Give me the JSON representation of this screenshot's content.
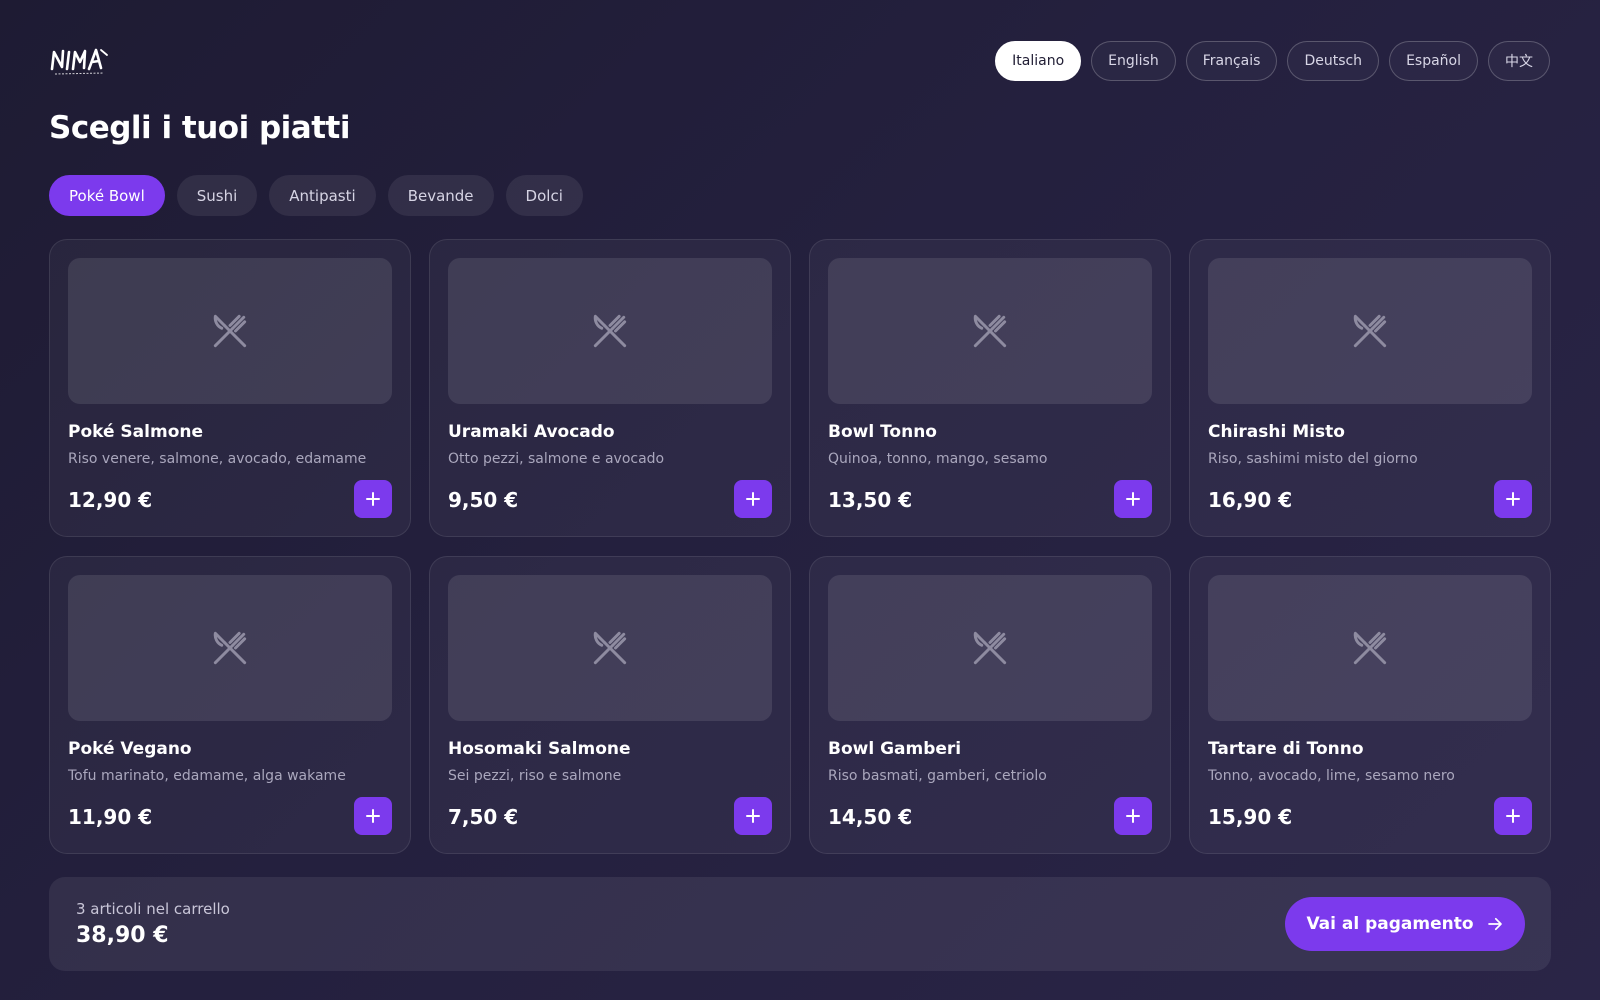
{
  "brand": {
    "logo_icon": "nima-logo"
  },
  "languages": [
    {
      "label": "Italiano",
      "active": true
    },
    {
      "label": "English",
      "active": false
    },
    {
      "label": "Français",
      "active": false
    },
    {
      "label": "Deutsch",
      "active": false
    },
    {
      "label": "Español",
      "active": false
    },
    {
      "label": "中文",
      "active": false
    }
  ],
  "page": {
    "title": "Scegli i tuoi piatti"
  },
  "categories": [
    {
      "label": "Poké Bowl",
      "active": true
    },
    {
      "label": "Sushi",
      "active": false
    },
    {
      "label": "Antipasti",
      "active": false
    },
    {
      "label": "Bevande",
      "active": false
    },
    {
      "label": "Dolci",
      "active": false
    }
  ],
  "dishes": [
    {
      "name": "Poké Salmone",
      "description": "Riso venere, salmone, avocado, edamame",
      "price": "12,90 €"
    },
    {
      "name": "Uramaki Avocado",
      "description": "Otto pezzi, salmone e avocado",
      "price": "9,50 €"
    },
    {
      "name": "Bowl Tonno",
      "description": "Quinoa, tonno, mango, sesamo",
      "price": "13,50 €"
    },
    {
      "name": "Chirashi Misto",
      "description": "Riso, sashimi misto del giorno",
      "price": "16,90 €"
    },
    {
      "name": "Poké Vegano",
      "description": "Tofu marinato, edamame, alga wakame",
      "price": "11,90 €"
    },
    {
      "name": "Hosomaki Salmone",
      "description": "Sei pezzi, riso e salmone",
      "price": "7,50 €"
    },
    {
      "name": "Bowl Gamberi",
      "description": "Riso basmati, gamberi, cetriolo",
      "price": "14,50 €"
    },
    {
      "name": "Tartare di Tonno",
      "description": "Tonno, avocado, lime, sesamo nero",
      "price": "15,90 €"
    }
  ],
  "cart": {
    "count_label": "3 articoli nel carrello",
    "total": "38,90 €",
    "checkout_label": "Vai al pagamento"
  },
  "icons": {
    "dish_placeholder": "fork-knife-icon",
    "add": "plus-icon",
    "checkout": "arrow-right-icon"
  },
  "colors": {
    "accent": "#7c3aed",
    "background": "#221e3a",
    "active_language_bg": "#ffffff"
  }
}
